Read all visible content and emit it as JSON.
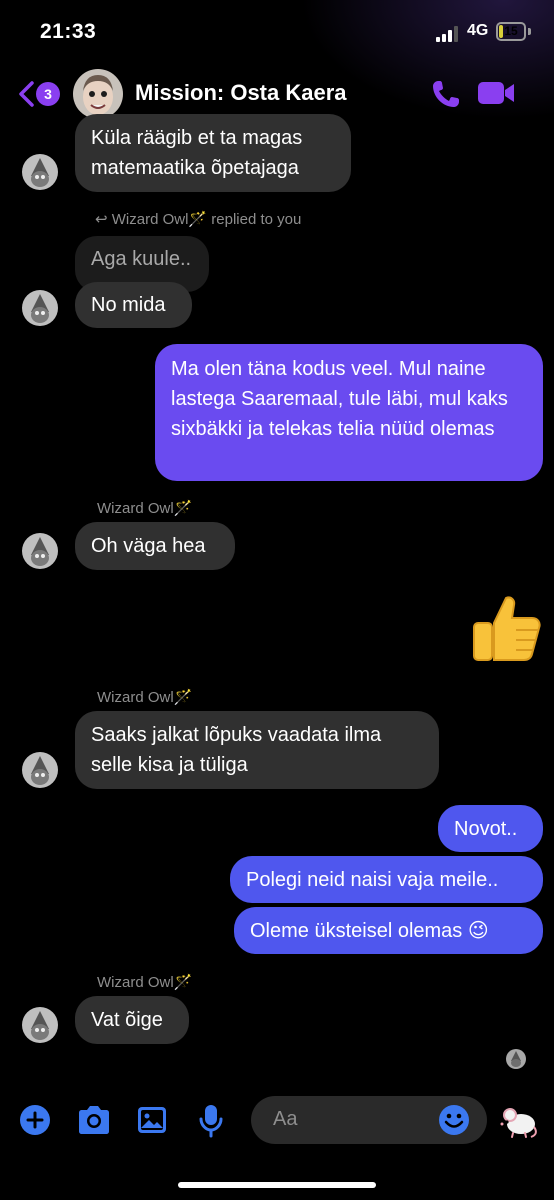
{
  "status_bar": {
    "time": "21:33",
    "network": "4G",
    "battery": "15",
    "battery_level": 0.15
  },
  "header": {
    "back_badge": "3",
    "title": "Mission: Osta Kaera"
  },
  "messages": {
    "m1": "Küla räägib et ta magas matemaatika õpetajaga",
    "reply_note": "Wizard Owl🪄 replied to you",
    "m2_quoted": "Aga kuule..",
    "m2": "No mida",
    "m3": "Ma olen täna kodus veel. Mul naine lastega Saaremaal, tule läbi, mul kaks sixbäkki ja telekas telia nüüd olemas",
    "sender1": "Wizard Owl🪄",
    "m4": "Oh väga hea",
    "m5_emoji": "👍",
    "sender2": "Wizard Owl🪄",
    "m6": "Saaks jalkat lõpuks vaadata ilma selle kisa ja tüliga",
    "m7": "Novot..",
    "m8": "Polegi neid naisi vaja meile..",
    "m9": "Oleme üksteisel olemas 😉",
    "sender3": "Wizard Owl🪄",
    "m10": "Vat õige"
  },
  "composer": {
    "placeholder": "Aa"
  },
  "icons": {
    "back": "chevron-left-icon",
    "call": "phone-icon",
    "video": "video-camera-icon",
    "plus": "plus-circle-icon",
    "camera": "camera-icon",
    "gallery": "image-icon",
    "mic": "microphone-icon",
    "emoji": "emoji-icon",
    "quick": "mouse-icon"
  },
  "colors": {
    "accent": "#8a3ff0",
    "outgoing": "#6a4bf0",
    "outgoing_blue": "#4f57ee",
    "incoming": "#303030",
    "icon_blue": "#3b78f0"
  }
}
